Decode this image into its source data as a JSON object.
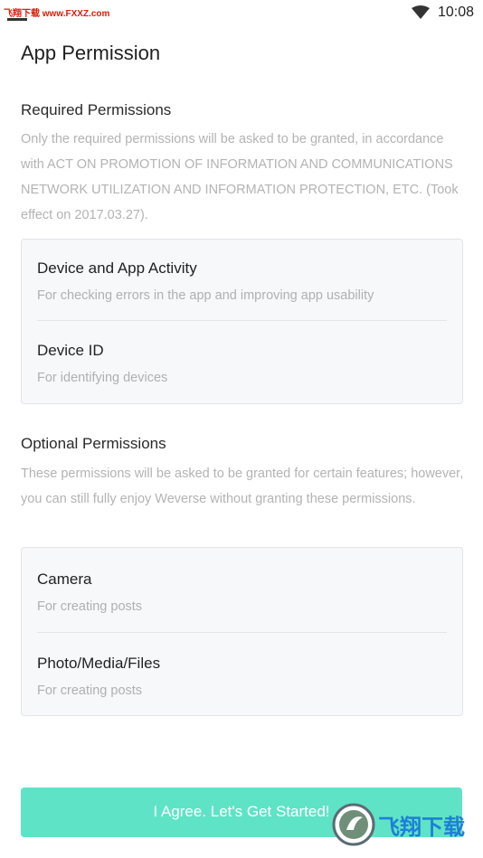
{
  "status_bar": {
    "watermark_text": "飞翔下载 www.FXXZ.com",
    "time": "10:08",
    "wifi_icon": "wifi-icon"
  },
  "page": {
    "title": "App Permission"
  },
  "required": {
    "title": "Required Permissions",
    "description": "Only the required permissions will be asked to be granted, in accordance with ACT ON PROMOTION OF INFORMATION AND COMMUNICATIONS NETWORK UTILIZATION AND INFORMATION PROTECTION, ETC. (Took effect on 2017.03.27).",
    "items": [
      {
        "name": "Device and App Activity",
        "desc": "For checking errors in the app and improving app usability"
      },
      {
        "name": "Device ID",
        "desc": "For identifying devices"
      }
    ]
  },
  "optional": {
    "title": "Optional Permissions",
    "description": "These permissions will be asked to be granted for certain features; however, you can still fully enjoy Weverse without granting these permissions.",
    "items": [
      {
        "name": "Camera",
        "desc": "For creating posts"
      },
      {
        "name": "Photo/Media/Files",
        "desc": "For creating posts"
      }
    ]
  },
  "footer": {
    "agree_label": "I Agree. Let's Get Started!",
    "button_color": "#5fe3c6"
  },
  "watermark": {
    "brand": "飞翔下载",
    "url": "WWW.FXXZ.COM"
  }
}
